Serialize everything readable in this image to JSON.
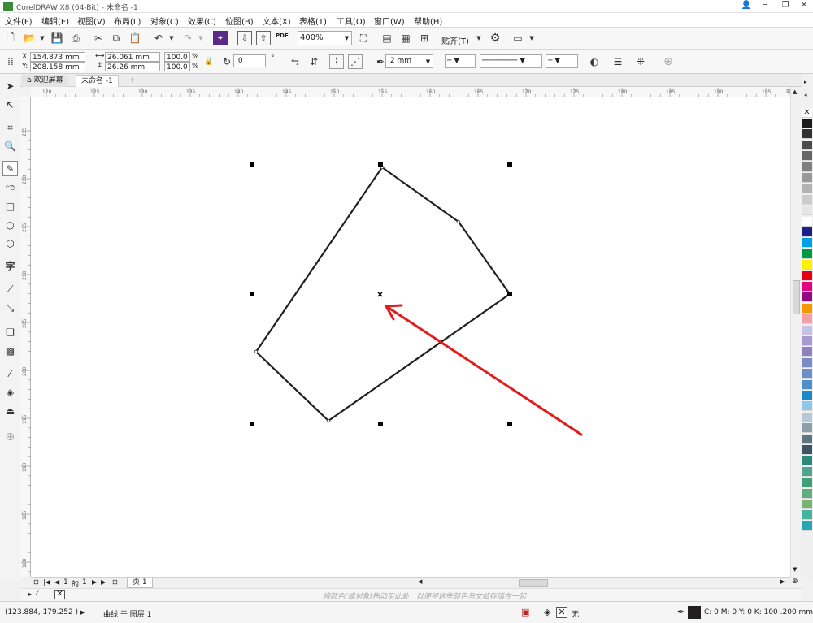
{
  "window": {
    "title": "CorelDRAW X8 (64-Bit) - 未命名 -1",
    "minimize": "─",
    "restore": "❐",
    "close": "✕",
    "help_icon": "👤"
  },
  "menu": [
    "文件(F)",
    "编辑(E)",
    "视图(V)",
    "布局(L)",
    "对象(C)",
    "效果(C)",
    "位图(B)",
    "文本(X)",
    "表格(T)",
    "工具(O)",
    "窗口(W)",
    "帮助(H)"
  ],
  "toolbar": {
    "pdf_label": "PDF",
    "zoom": "400%",
    "snap_label": "贴齐(T)"
  },
  "props": {
    "x_label": "X:",
    "x": "154.873 mm",
    "y_label": "Y:",
    "y": "208.158 mm",
    "w": "26.061 mm",
    "h": "26.26 mm",
    "scale_w": "100.0",
    "scale_h": "100.0",
    "pct": "%",
    "angle": ".0",
    "angle_unit": "°",
    "outline_width": ".2 mm"
  },
  "tabs": {
    "welcome": "欢迎屏幕",
    "doc": "未命名 -1",
    "add": "+"
  },
  "ruler": {
    "h_ticks": [
      "120",
      "125",
      "130",
      "135",
      "140",
      "145",
      "150",
      "155",
      "160",
      "165",
      "170",
      "175",
      "180",
      "185",
      "190",
      "195"
    ],
    "h_unit": "毫米",
    "v_ticks": [
      "225",
      "220",
      "215",
      "210",
      "205",
      "200",
      "195",
      "190",
      "185",
      "180"
    ]
  },
  "page_nav": {
    "current": "1",
    "of": "的",
    "total": "1",
    "page_tab": "页 1"
  },
  "hint": "将颜色(或对象)拖动至此处，以便将这些颜色与文档存储在一起",
  "status": {
    "coords": "(123.884, 179.252 )",
    "object_info": "曲线 于 图层 1",
    "fill_none": "无",
    "outline_info": "C: 0 M: 0 Y: 0 K: 100  .200 mm"
  },
  "colors": {
    "shape_stroke": "#231f20",
    "arrow": "#e21b1b",
    "palette": [
      "#1a1a1a",
      "#333333",
      "#4d4d4d",
      "#666666",
      "#808080",
      "#999999",
      "#b3b3b3",
      "#cccccc",
      "#e6e6e6",
      "#ffffff",
      "#1d2088",
      "#00a0e9",
      "#009944",
      "#fff100",
      "#e60012",
      "#e4007f",
      "#920783",
      "#f39800",
      "#f3a0a9",
      "#c6c3e3",
      "#a59bcf",
      "#8f82bc",
      "#7b8ac6",
      "#6d8ec8",
      "#4e8ec9",
      "#1b88c7",
      "#8fc7e8",
      "#b5c9d6",
      "#8ba0ad",
      "#5f7582",
      "#3e5563",
      "#2c8a7a",
      "#52a48e",
      "#3f9f76",
      "#63ad7a",
      "#78b36f",
      "#46b3a0",
      "#27a5b5"
    ]
  }
}
